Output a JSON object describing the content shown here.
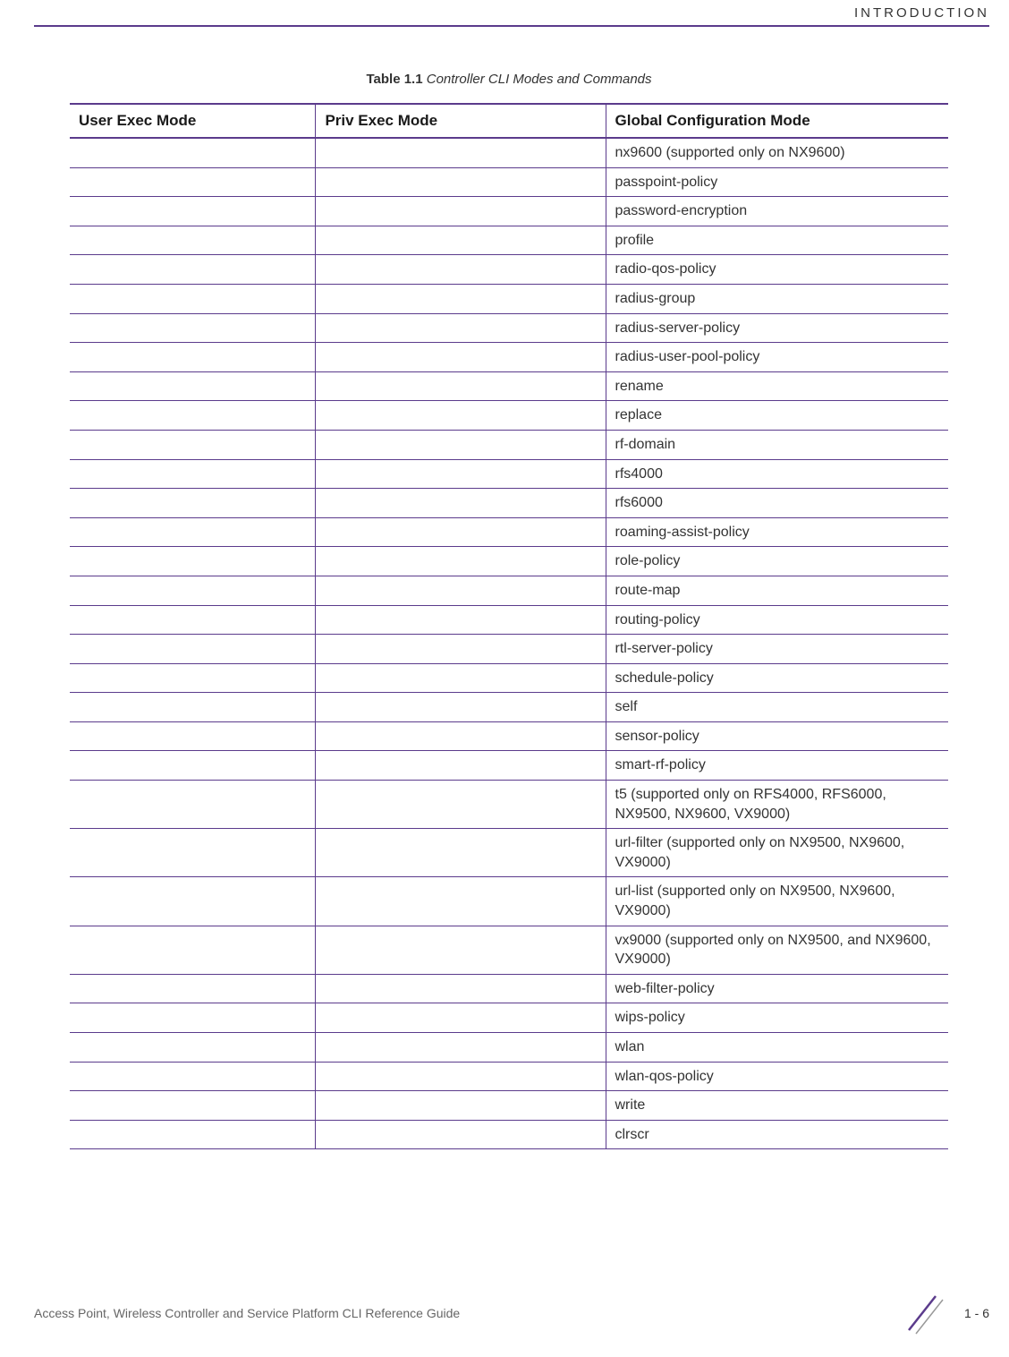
{
  "header_section": "INTRODUCTION",
  "table_label": "Table 1.1",
  "table_title": "Controller CLI Modes and Commands",
  "columns": {
    "col1": "User Exec Mode",
    "col2": "Priv Exec Mode",
    "col3": "Global Configuration Mode"
  },
  "rows": [
    {
      "c1": "",
      "c2": "",
      "c3": "nx9600 (supported only on NX9600)"
    },
    {
      "c1": "",
      "c2": "",
      "c3": "passpoint-policy"
    },
    {
      "c1": "",
      "c2": "",
      "c3": "password-encryption"
    },
    {
      "c1": "",
      "c2": "",
      "c3": "profile"
    },
    {
      "c1": "",
      "c2": "",
      "c3": "radio-qos-policy"
    },
    {
      "c1": "",
      "c2": "",
      "c3": "radius-group"
    },
    {
      "c1": "",
      "c2": "",
      "c3": "radius-server-policy"
    },
    {
      "c1": "",
      "c2": "",
      "c3": "radius-user-pool-policy"
    },
    {
      "c1": "",
      "c2": "",
      "c3": "rename"
    },
    {
      "c1": "",
      "c2": "",
      "c3": "replace"
    },
    {
      "c1": "",
      "c2": "",
      "c3": "rf-domain"
    },
    {
      "c1": "",
      "c2": "",
      "c3": "rfs4000"
    },
    {
      "c1": "",
      "c2": "",
      "c3": "rfs6000"
    },
    {
      "c1": "",
      "c2": "",
      "c3": "roaming-assist-policy"
    },
    {
      "c1": "",
      "c2": "",
      "c3": "role-policy"
    },
    {
      "c1": "",
      "c2": "",
      "c3": "route-map"
    },
    {
      "c1": "",
      "c2": "",
      "c3": "routing-policy"
    },
    {
      "c1": "",
      "c2": "",
      "c3": "rtl-server-policy"
    },
    {
      "c1": "",
      "c2": "",
      "c3": "schedule-policy"
    },
    {
      "c1": "",
      "c2": "",
      "c3": "self"
    },
    {
      "c1": "",
      "c2": "",
      "c3": "sensor-policy"
    },
    {
      "c1": "",
      "c2": "",
      "c3": "smart-rf-policy"
    },
    {
      "c1": "",
      "c2": "",
      "c3": "t5 (supported only on RFS4000, RFS6000, NX9500, NX9600, VX9000)"
    },
    {
      "c1": "",
      "c2": "",
      "c3": "url-filter (supported only on NX9500, NX9600, VX9000)"
    },
    {
      "c1": "",
      "c2": "",
      "c3": "url-list (supported only on NX9500, NX9600, VX9000)"
    },
    {
      "c1": "",
      "c2": "",
      "c3": "vx9000 (supported only on NX9500, and NX9600, VX9000)"
    },
    {
      "c1": "",
      "c2": "",
      "c3": "web-filter-policy"
    },
    {
      "c1": "",
      "c2": "",
      "c3": "wips-policy"
    },
    {
      "c1": "",
      "c2": "",
      "c3": "wlan"
    },
    {
      "c1": "",
      "c2": "",
      "c3": "wlan-qos-policy"
    },
    {
      "c1": "",
      "c2": "",
      "c3": "write"
    },
    {
      "c1": "",
      "c2": "",
      "c3": "clrscr"
    }
  ],
  "footer_text": "Access Point, Wireless Controller and Service Platform CLI Reference Guide",
  "page_number": "1 - 6"
}
